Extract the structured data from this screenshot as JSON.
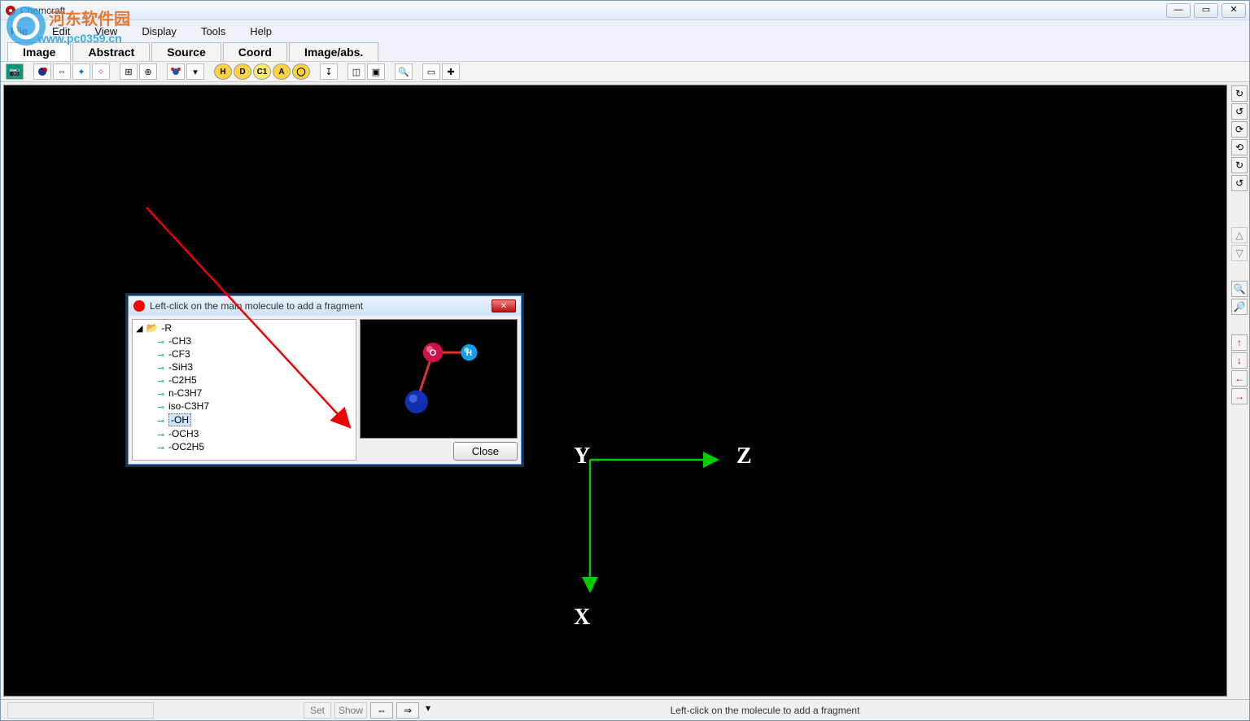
{
  "window": {
    "title": "Chemcraft",
    "menu": [
      "File",
      "Edit",
      "View",
      "Display",
      "Tools",
      "Help"
    ],
    "tabs": [
      "Image",
      "Abstract",
      "Source",
      "Coord",
      "Image/abs."
    ],
    "active_tab": 0
  },
  "toolbar_labels": {
    "H": "H",
    "D": "D",
    "C1": "C1",
    "A": "A",
    "ring": "◯"
  },
  "axes": {
    "x": "X",
    "y": "Y",
    "z": "Z"
  },
  "dialog": {
    "title": "Left-click on the main molecule to add a fragment",
    "close": "Close",
    "tree_root": "-R",
    "items": [
      "-CH3",
      "-CF3",
      "-SiH3",
      "-C2H5",
      "n-C3H7",
      "iso-C3H7",
      "-OH",
      "-OCH3",
      "-OC2H5"
    ],
    "selected": "-OH",
    "preview_atoms": {
      "O": "O",
      "H": "H"
    }
  },
  "statusbar": {
    "buttons": [
      "Set",
      "Show"
    ],
    "message": "Left-click on the molecule to add a fragment"
  },
  "watermark": {
    "line1": "河东软件园",
    "line2": "www.pc0359.cn"
  }
}
